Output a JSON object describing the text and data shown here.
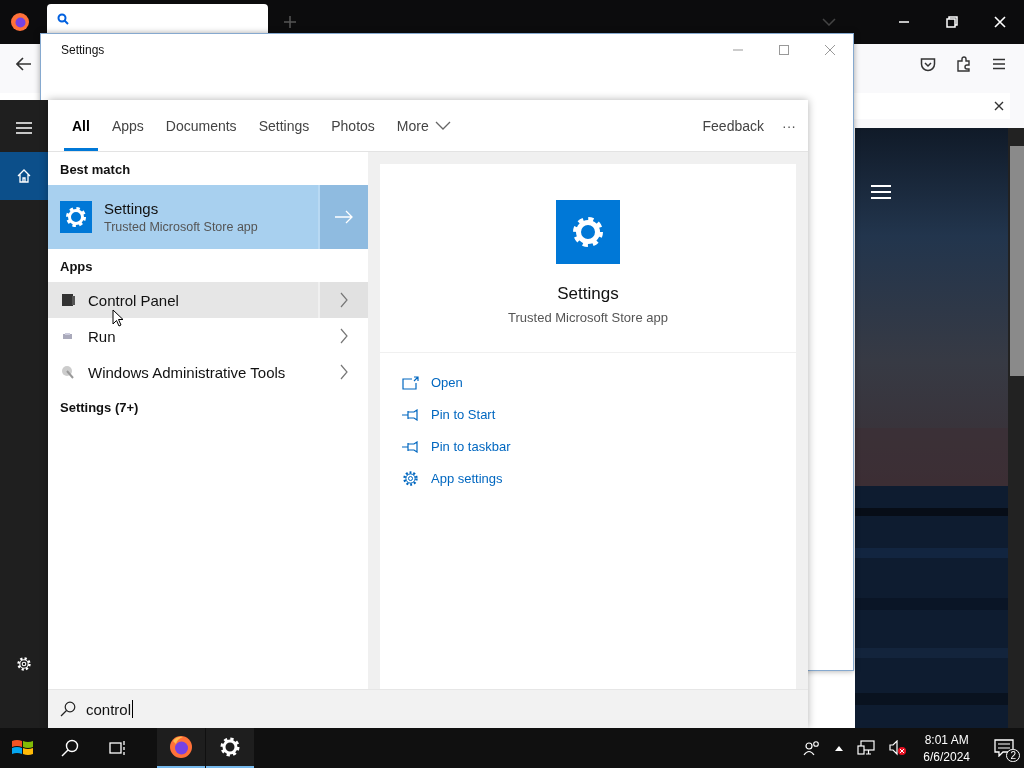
{
  "settings_window": {
    "title": "Settings"
  },
  "start_rail": [
    {
      "kind": "menu",
      "selected": false
    },
    {
      "kind": "home",
      "selected": true
    },
    {
      "kind": "settings",
      "selected": false
    }
  ],
  "search": {
    "tabs": [
      {
        "label": "All",
        "selected": true,
        "kind": "tab"
      },
      {
        "label": "Apps",
        "selected": false,
        "kind": "tab"
      },
      {
        "label": "Documents",
        "selected": false,
        "kind": "tab"
      },
      {
        "label": "Settings",
        "selected": false,
        "kind": "tab"
      },
      {
        "label": "Photos",
        "selected": false,
        "kind": "tab"
      },
      {
        "label": "More",
        "selected": false,
        "kind": "dropdown"
      }
    ],
    "feedback": "Feedback",
    "more_options": "···",
    "sections": [
      {
        "heading": "Best match",
        "items": [
          {
            "name": "Settings",
            "subtitle": "Trusted Microsoft Store app",
            "selected": true,
            "hovered": false
          }
        ]
      },
      {
        "heading": "Apps",
        "items": [
          {
            "name": "Control Panel",
            "selected": false,
            "hovered": true
          },
          {
            "name": "Run",
            "selected": false,
            "hovered": false
          },
          {
            "name": "Windows Administrative Tools",
            "selected": false,
            "hovered": false
          }
        ]
      },
      {
        "heading": "Settings (7+)"
      }
    ],
    "preview": {
      "name": "Settings",
      "subtitle": "Trusted Microsoft Store app",
      "actions": [
        {
          "label": "Open"
        },
        {
          "label": "Pin to Start"
        },
        {
          "label": "Pin to taskbar"
        },
        {
          "label": "App settings"
        }
      ]
    },
    "query": "control"
  },
  "taskbar": {
    "apps": [
      {
        "kind": "browser",
        "running": true
      },
      {
        "kind": "settings",
        "running": true
      }
    ],
    "time": "8:01 AM",
    "date": "6/6/2024",
    "notifications": "2"
  }
}
